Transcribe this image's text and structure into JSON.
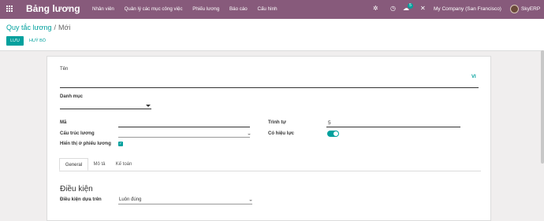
{
  "topbar": {
    "app_title": "Bảng lương",
    "menu": [
      "Nhân viên",
      "Quản lý các mục công việc",
      "Phiếu lương",
      "Báo cáo",
      "Cấu hình"
    ],
    "chat_badge": "5",
    "company": "My Company (San Francisco)",
    "user": "SkyERP"
  },
  "breadcrumb": {
    "parent": "Quy tắc lương",
    "separator": "/",
    "current": "Mới"
  },
  "actions": {
    "save": "LƯU",
    "discard": "HUỶ BỎ"
  },
  "form": {
    "name_label": "Tên",
    "lang": "VI",
    "category_label": "Danh mục",
    "code_label": "Mã",
    "sequence_label": "Trình tự",
    "sequence_value": "5",
    "structure_label": "Cấu trúc lương",
    "active_label": "Có hiệu lực",
    "show_on_payslip_label": "Hiển thị ở phiếu lương",
    "tabs": [
      "General",
      "Mô tả",
      "Kế toán"
    ],
    "section_title": "Điều kiện",
    "condition_label": "Điều kiện dựa trên",
    "condition_value": "Luôn đúng"
  },
  "colors": {
    "brand": "#875a7b",
    "accent": "#00a09d"
  },
  "state": {
    "active": true,
    "show_on_payslip": true
  }
}
